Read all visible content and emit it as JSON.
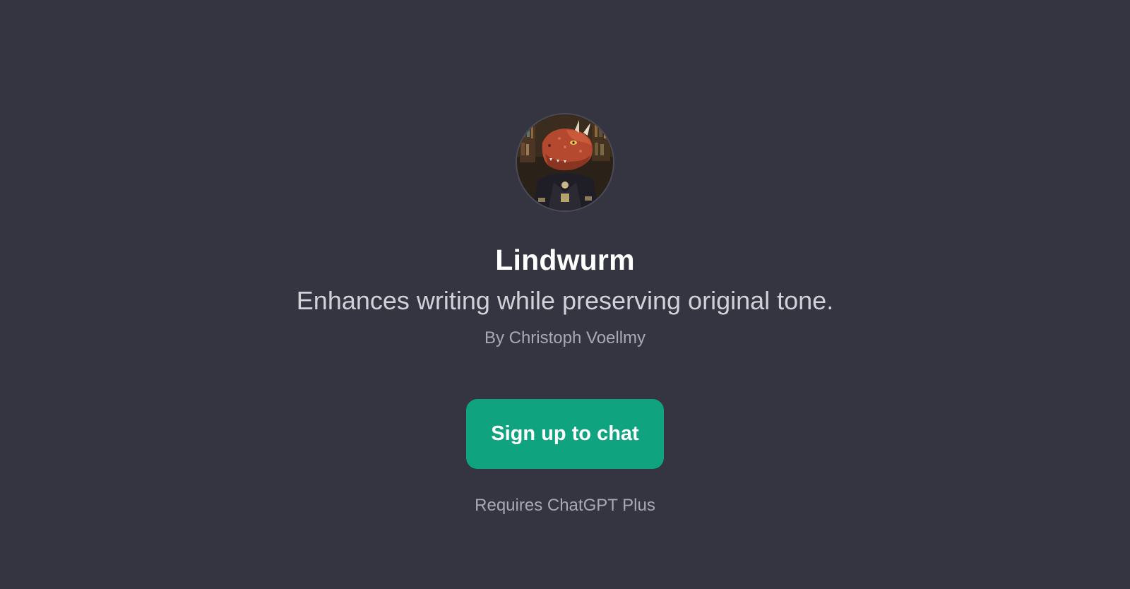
{
  "gpt": {
    "name": "Lindwurm",
    "description": "Enhances writing while preserving original tone.",
    "author": "By Christoph Voellmy",
    "avatar_icon": "dragon-portrait-avatar"
  },
  "cta": {
    "label": "Sign up to chat",
    "note": "Requires ChatGPT Plus"
  },
  "colors": {
    "background": "#343541",
    "accent": "#10a37f",
    "text_primary": "#ffffff",
    "text_secondary": "#d1d1d8",
    "text_muted": "#a9a9b3"
  }
}
